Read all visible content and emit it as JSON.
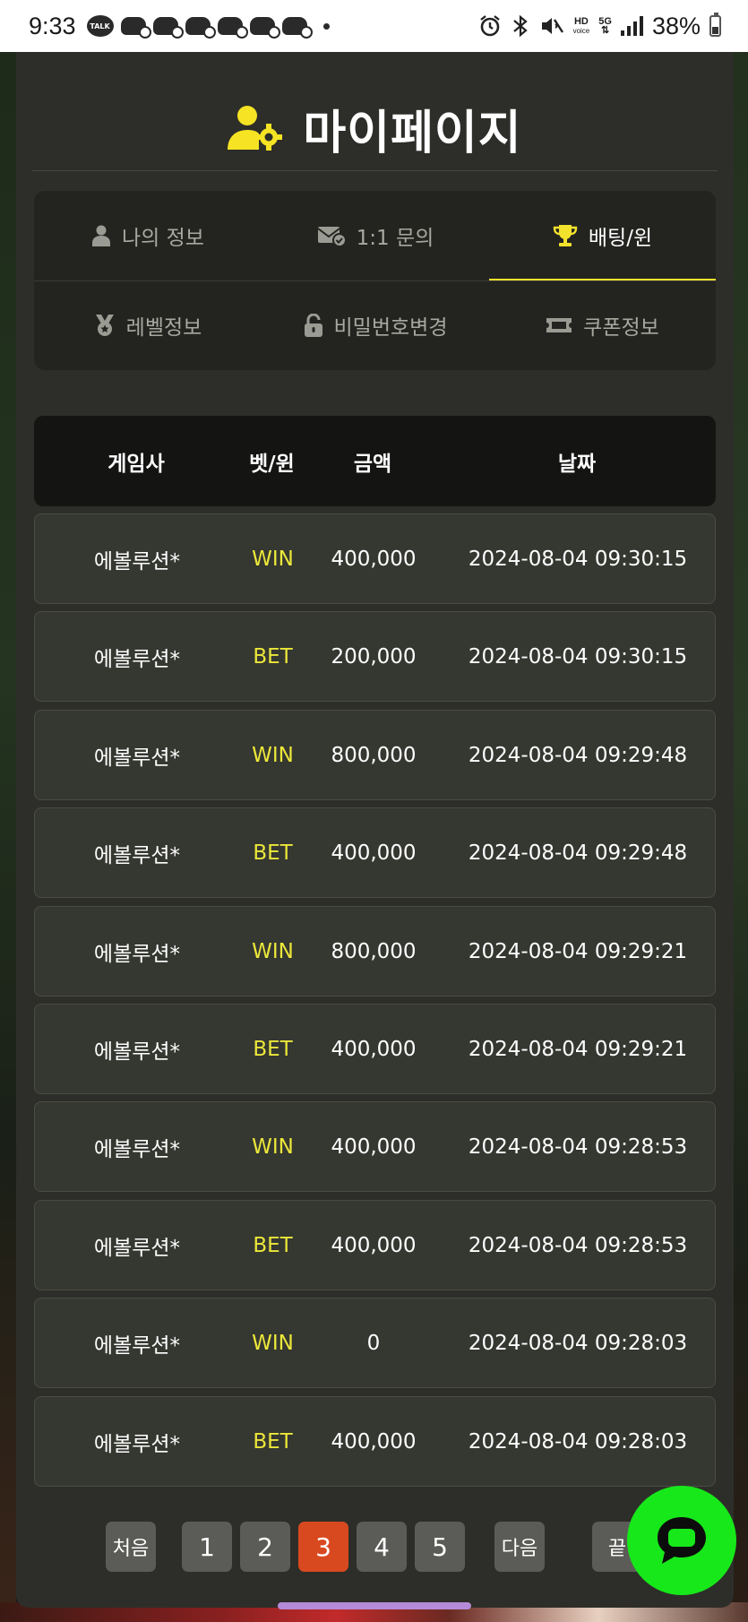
{
  "status_bar": {
    "time": "9:33",
    "talk_label": "TALK",
    "battery": "38%",
    "hd_top": "HD",
    "hd_bottom": "voice",
    "net": "5G"
  },
  "page": {
    "title": "마이페이지"
  },
  "tabs": [
    {
      "label": "나의 정보",
      "icon": "user-icon",
      "active": false
    },
    {
      "label": "1:1 문의",
      "icon": "envelope-check-icon",
      "active": false
    },
    {
      "label": "배팅/윈",
      "icon": "trophy-icon",
      "active": true
    },
    {
      "label": "레벨정보",
      "icon": "medal-icon",
      "active": false
    },
    {
      "label": "비밀번호변경",
      "icon": "lock-icon",
      "active": false
    },
    {
      "label": "쿠폰정보",
      "icon": "ticket-icon",
      "active": false
    }
  ],
  "table": {
    "headers": [
      "게임사",
      "벳/윈",
      "금액",
      "날짜"
    ],
    "rows": [
      {
        "provider": "에볼루션*",
        "type": "WIN",
        "amount": "400,000",
        "date": "2024-08-04 09:30:15"
      },
      {
        "provider": "에볼루션*",
        "type": "BET",
        "amount": "200,000",
        "date": "2024-08-04 09:30:15"
      },
      {
        "provider": "에볼루션*",
        "type": "WIN",
        "amount": "800,000",
        "date": "2024-08-04 09:29:48"
      },
      {
        "provider": "에볼루션*",
        "type": "BET",
        "amount": "400,000",
        "date": "2024-08-04 09:29:48"
      },
      {
        "provider": "에볼루션*",
        "type": "WIN",
        "amount": "800,000",
        "date": "2024-08-04 09:29:21"
      },
      {
        "provider": "에볼루션*",
        "type": "BET",
        "amount": "400,000",
        "date": "2024-08-04 09:29:21"
      },
      {
        "provider": "에볼루션*",
        "type": "WIN",
        "amount": "400,000",
        "date": "2024-08-04 09:28:53"
      },
      {
        "provider": "에볼루션*",
        "type": "BET",
        "amount": "400,000",
        "date": "2024-08-04 09:28:53"
      },
      {
        "provider": "에볼루션*",
        "type": "WIN",
        "amount": "0",
        "date": "2024-08-04 09:28:03"
      },
      {
        "provider": "에볼루션*",
        "type": "BET",
        "amount": "400,000",
        "date": "2024-08-04 09:28:03"
      }
    ]
  },
  "pagination": {
    "first": "처음",
    "pages": [
      "1",
      "2",
      "3",
      "4",
      "5"
    ],
    "current": "3",
    "next": "다음",
    "last": "끝"
  },
  "colors": {
    "accent_yellow": "#f3e22c",
    "bet_win_text": "#ece73a",
    "current_page": "#d9491f",
    "chat_button": "#17e81a",
    "panel": "#2d2e29"
  }
}
